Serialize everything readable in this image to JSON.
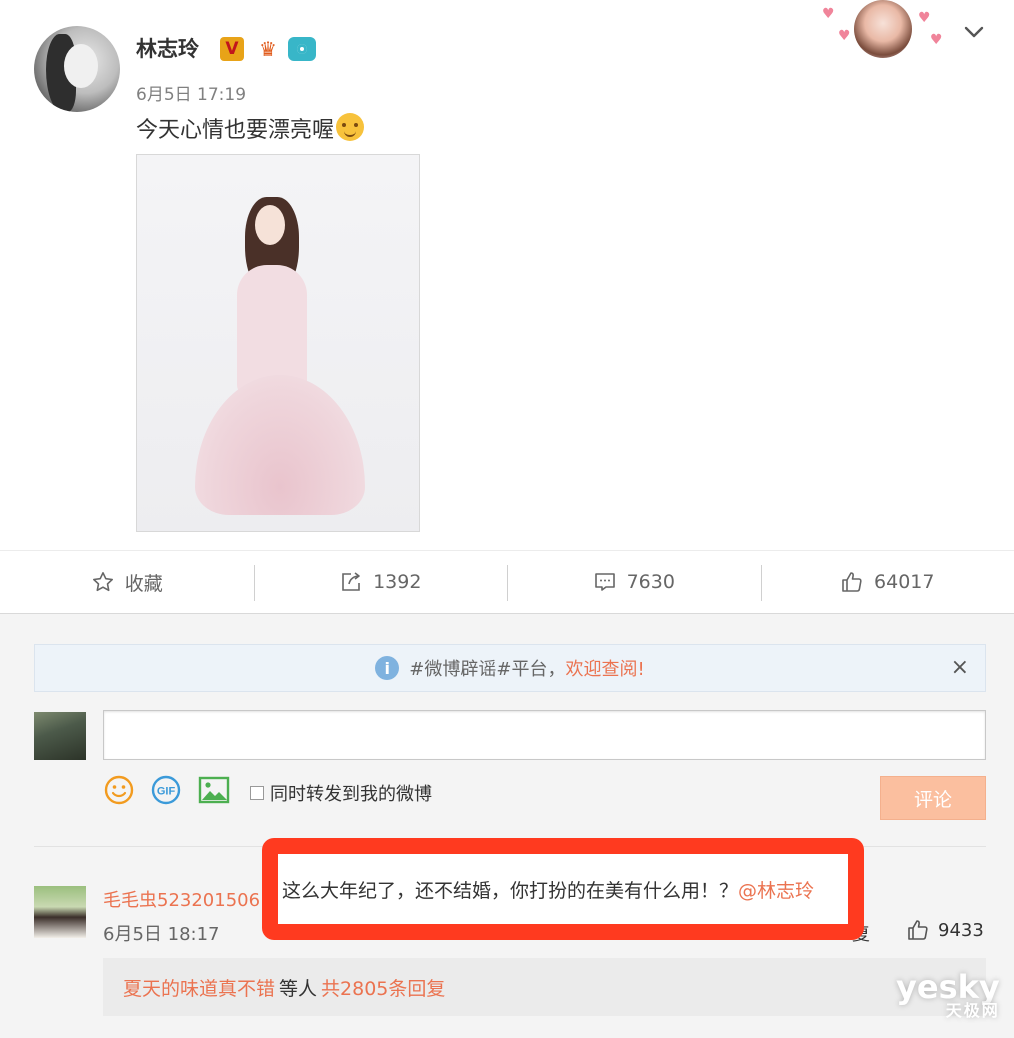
{
  "post": {
    "author": "林志玲",
    "time": "6月5日 17:19",
    "text": "今天心情也要漂亮喔",
    "badges": {
      "verified": "V"
    },
    "emoji_icon": "hugging-face-emoji"
  },
  "actions": {
    "favorite_label": "收藏",
    "repost_count": "1392",
    "comment_count": "7630",
    "like_count": "64017"
  },
  "notice": {
    "prefix": "#微博辟谣#平台，",
    "link": "欢迎查阅!",
    "close": "×"
  },
  "composer": {
    "placeholder": "",
    "sync_label": "同时转发到我的微博",
    "submit_label": "评论"
  },
  "comment": {
    "user": "毛毛虫523201506",
    "time": "6月5日 18:17",
    "text": "这么大年纪了，还不结婚，你打扮的在美有什么用！？",
    "mention": "@林志玲",
    "reply_label": "复",
    "like_count": "9433",
    "replies_user": "夏天的味道真不错",
    "replies_middle": "等人",
    "replies_total": "共2805条回复"
  },
  "watermark": {
    "main": "yesky",
    "sub": "天极网"
  },
  "colors": {
    "accent": "#eb7350",
    "highlight_border": "#ff3a1f",
    "submit_bg": "#fbbf9f"
  }
}
